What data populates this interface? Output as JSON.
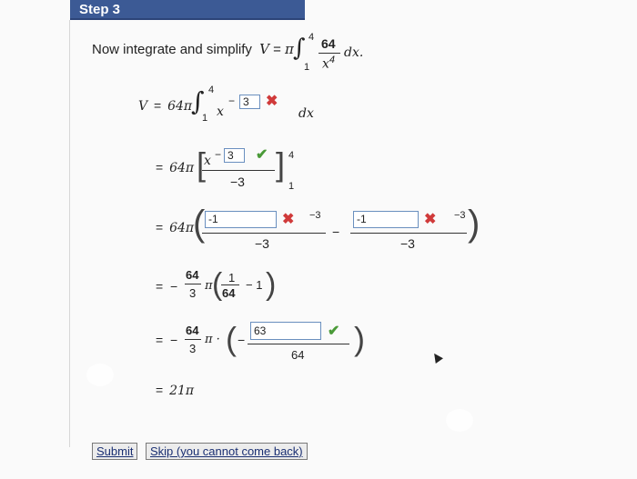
{
  "header": {
    "title": "Step 3"
  },
  "intro": {
    "text": "Now integrate and simplify",
    "formula_var": "V",
    "eq": "=",
    "pi": "π",
    "lower": "1",
    "upper": "4",
    "num": "64",
    "den": "x",
    "den_exp": "4",
    "dx": "dx."
  },
  "line1": {
    "lhs": "V",
    "eq": "=",
    "coef": "64π",
    "lower": "1",
    "upper": "4",
    "base": "x",
    "minus": "−",
    "answer": "3",
    "dx": "dx"
  },
  "line2": {
    "eq": "=",
    "coef": "64π",
    "base": "x",
    "minus": "−",
    "answer": "3",
    "den": "−3",
    "upper": "4",
    "lower": "1"
  },
  "line3": {
    "eq": "=",
    "coef": "64π",
    "answer1": "-1",
    "exp1": "−3",
    "den1": "−3",
    "minus": "−",
    "answer2": "-1",
    "exp2": "−3",
    "den2": "−3"
  },
  "line4": {
    "eq": "=",
    "neg": "−",
    "num": "64",
    "den": "3",
    "pi": "π",
    "inner_num": "1",
    "inner_den": "64",
    "minus_one": "− 1"
  },
  "line5": {
    "eq": "=",
    "neg": "−",
    "num": "64",
    "den": "3",
    "pi": "π ·",
    "inner_neg": "−",
    "answer": "63",
    "den2": "64"
  },
  "line6": {
    "eq": "=",
    "value": "21π"
  },
  "buttons": {
    "submit": "Submit",
    "skip": "Skip (you cannot come back)"
  },
  "colors": {
    "header_bg": "#3c5a95",
    "box_border": "#6a8fbf",
    "incorrect": "#d03a3a",
    "correct": "#4a9a38"
  },
  "icons": {
    "incorrect": "x-mark-icon",
    "correct": "check-mark-icon"
  }
}
